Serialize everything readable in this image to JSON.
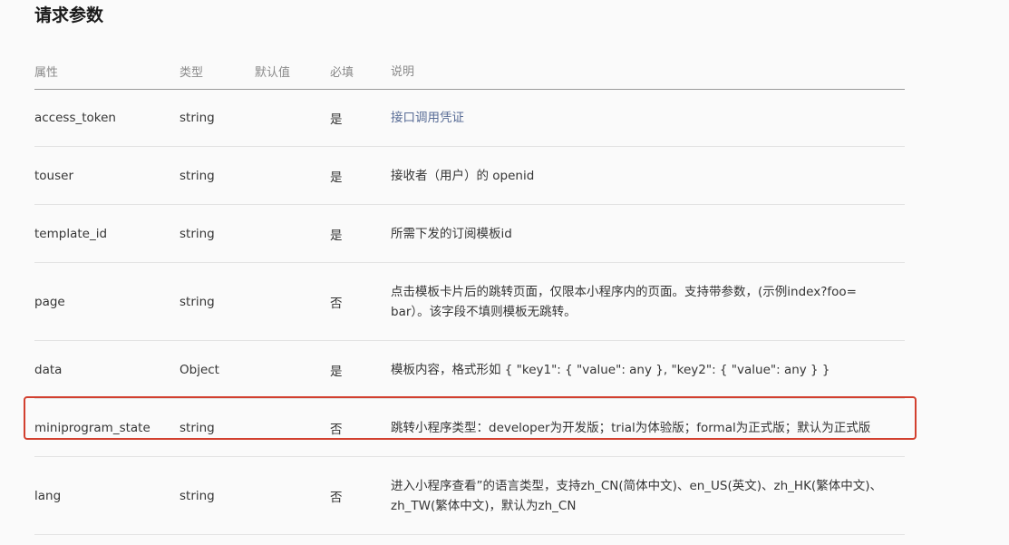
{
  "title": "请求参数",
  "columns": {
    "name": "属性",
    "type": "类型",
    "default": "默认值",
    "required": "必填",
    "desc": "说明"
  },
  "rows": [
    {
      "name": "access_token",
      "type": "string",
      "default": "",
      "required": "是",
      "desc": "接口调用凭证",
      "desc_is_link": true
    },
    {
      "name": "touser",
      "type": "string",
      "default": "",
      "required": "是",
      "desc": "接收者（用户）的 openid"
    },
    {
      "name": "template_id",
      "type": "string",
      "default": "",
      "required": "是",
      "desc": "所需下发的订阅模板id"
    },
    {
      "name": "page",
      "type": "string",
      "default": "",
      "required": "否",
      "desc": "点击模板卡片后的跳转页面，仅限本小程序内的页面。支持带参数，(示例index?foo=bar）。该字段不填则模板无跳转。"
    },
    {
      "name": "data",
      "type": "Object",
      "default": "",
      "required": "是",
      "desc": "模板内容，格式形如 { \"key1\": { \"value\": any }, \"key2\": { \"value\": any } }"
    },
    {
      "name": "miniprogram_state",
      "type": "string",
      "default": "",
      "required": "否",
      "desc": "跳转小程序类型：developer为开发版；trial为体验版；formal为正式版；默认为正式版",
      "highlighted": true
    },
    {
      "name": "lang",
      "type": "string",
      "default": "",
      "required": "否",
      "desc": "进入小程序查看”的语言类型，支持zh_CN(简体中文)、en_US(英文)、zh_HK(繁体中文)、zh_TW(繁体中文)，默认为zh_CN"
    }
  ]
}
